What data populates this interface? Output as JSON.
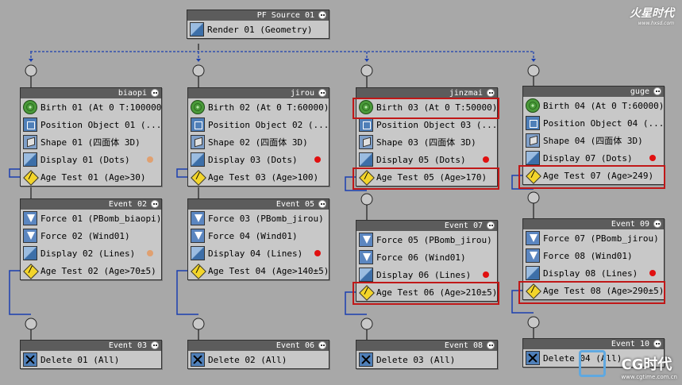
{
  "source": {
    "title": "PF Source 01",
    "operator": "Render 01 (Geometry)"
  },
  "columns": [
    {
      "event": {
        "title": "biaopi",
        "ops": [
          {
            "icon": "birth-icon",
            "label": "Birth 01 (At 0 T:100000)"
          },
          {
            "icon": "position-icon",
            "label": "Position Object 01 (..."
          },
          {
            "icon": "shape-icon",
            "label": "Shape 01 (四面体 3D)"
          },
          {
            "icon": "display-icon",
            "label": "Display 01 (Dots)",
            "dot": "#e0a070"
          },
          {
            "icon": "age-test-icon",
            "label": "Age Test 01 (Age>30)"
          }
        ]
      },
      "forces": {
        "title": "Event 02",
        "ops": [
          {
            "icon": "force-icon",
            "label": "Force 01 (PBomb_biaopi)"
          },
          {
            "icon": "force-icon",
            "label": "Force 02 (Wind01)"
          },
          {
            "icon": "display-icon",
            "label": "Display 02 (Lines)",
            "dot": "#e0a070"
          },
          {
            "icon": "age-test-icon",
            "label": "Age Test 02 (Age>70±5)"
          }
        ]
      },
      "delete": {
        "title": "Event 03",
        "ops": [
          {
            "icon": "delete-icon",
            "label": "Delete 01 (All)"
          }
        ]
      }
    },
    {
      "event": {
        "title": "jirou",
        "ops": [
          {
            "icon": "birth-icon",
            "label": "Birth 02 (At 0 T:60000)"
          },
          {
            "icon": "position-icon",
            "label": "Position Object 02 (..."
          },
          {
            "icon": "shape-icon",
            "label": "Shape 02 (四面体 3D)"
          },
          {
            "icon": "display-icon",
            "label": "Display 03 (Dots)",
            "dot": "#e01010"
          },
          {
            "icon": "age-test-icon",
            "label": "Age Test 03 (Age>100)"
          }
        ]
      },
      "forces": {
        "title": "Event 05",
        "ops": [
          {
            "icon": "force-icon",
            "label": "Force 03 (PBomb_jirou)"
          },
          {
            "icon": "force-icon",
            "label": "Force 04 (Wind01)"
          },
          {
            "icon": "display-icon",
            "label": "Display 04 (Lines)",
            "dot": "#e01010"
          },
          {
            "icon": "age-test-icon",
            "label": "Age Test 04 (Age>140±5)"
          }
        ]
      },
      "delete": {
        "title": "Event 06",
        "ops": [
          {
            "icon": "delete-icon",
            "label": "Delete 02 (All)"
          }
        ]
      }
    },
    {
      "event": {
        "title": "jinzmai",
        "ops": [
          {
            "icon": "birth-icon",
            "label": "Birth 03 (At 0 T:50000)"
          },
          {
            "icon": "position-icon",
            "label": "Position Object 03 (..."
          },
          {
            "icon": "shape-icon",
            "label": "Shape 03 (四面体 3D)"
          },
          {
            "icon": "display-icon",
            "label": "Display 05 (Dots)",
            "dot": "#e01010"
          },
          {
            "icon": "age-test-icon",
            "label": "Age Test 05 (Age>170)"
          }
        ]
      },
      "forces": {
        "title": "Event 07",
        "ops": [
          {
            "icon": "force-icon",
            "label": "Force 05 (PBomb_jirou)"
          },
          {
            "icon": "force-icon",
            "label": "Force 06 (Wind01)"
          },
          {
            "icon": "display-icon",
            "label": "Display 06 (Lines)",
            "dot": "#e01010"
          },
          {
            "icon": "age-test-icon",
            "label": "Age Test 06 (Age>210±5)"
          }
        ]
      },
      "delete": {
        "title": "Event 08",
        "ops": [
          {
            "icon": "delete-icon",
            "label": "Delete 03 (All)"
          }
        ]
      }
    },
    {
      "event": {
        "title": "guge",
        "ops": [
          {
            "icon": "birth-icon",
            "label": "Birth 04 (At 0 T:60000)"
          },
          {
            "icon": "position-icon",
            "label": "Position Object 04 (..."
          },
          {
            "icon": "shape-icon",
            "label": "Shape 04 (四面体 3D)"
          },
          {
            "icon": "display-icon",
            "label": "Display 07 (Dots)",
            "dot": "#e01010"
          },
          {
            "icon": "age-test-icon",
            "label": "Age Test 07 (Age>249)"
          }
        ]
      },
      "forces": {
        "title": "Event 09",
        "ops": [
          {
            "icon": "force-icon",
            "label": "Force 07 (PBomb_jirou)"
          },
          {
            "icon": "force-icon",
            "label": "Force 08 (Wind01)"
          },
          {
            "icon": "display-icon",
            "label": "Display 08 (Lines)",
            "dot": "#e01010"
          },
          {
            "icon": "age-test-icon",
            "label": "Age Test 08 (Age>290±5)"
          }
        ]
      },
      "delete": {
        "title": "Event 10",
        "ops": [
          {
            "icon": "delete-icon",
            "label": "Delete 04 (All)"
          }
        ]
      }
    }
  ],
  "watermarks": {
    "top": "火星时代",
    "top_url": "www.hxsd.com",
    "bottom": "CG时代",
    "bottom_url": "www.cgtime.com.cn"
  },
  "colors": {
    "wire": "#1a3fb0",
    "highlight": "#c01818",
    "title_bar": "#5c5c5c"
  }
}
